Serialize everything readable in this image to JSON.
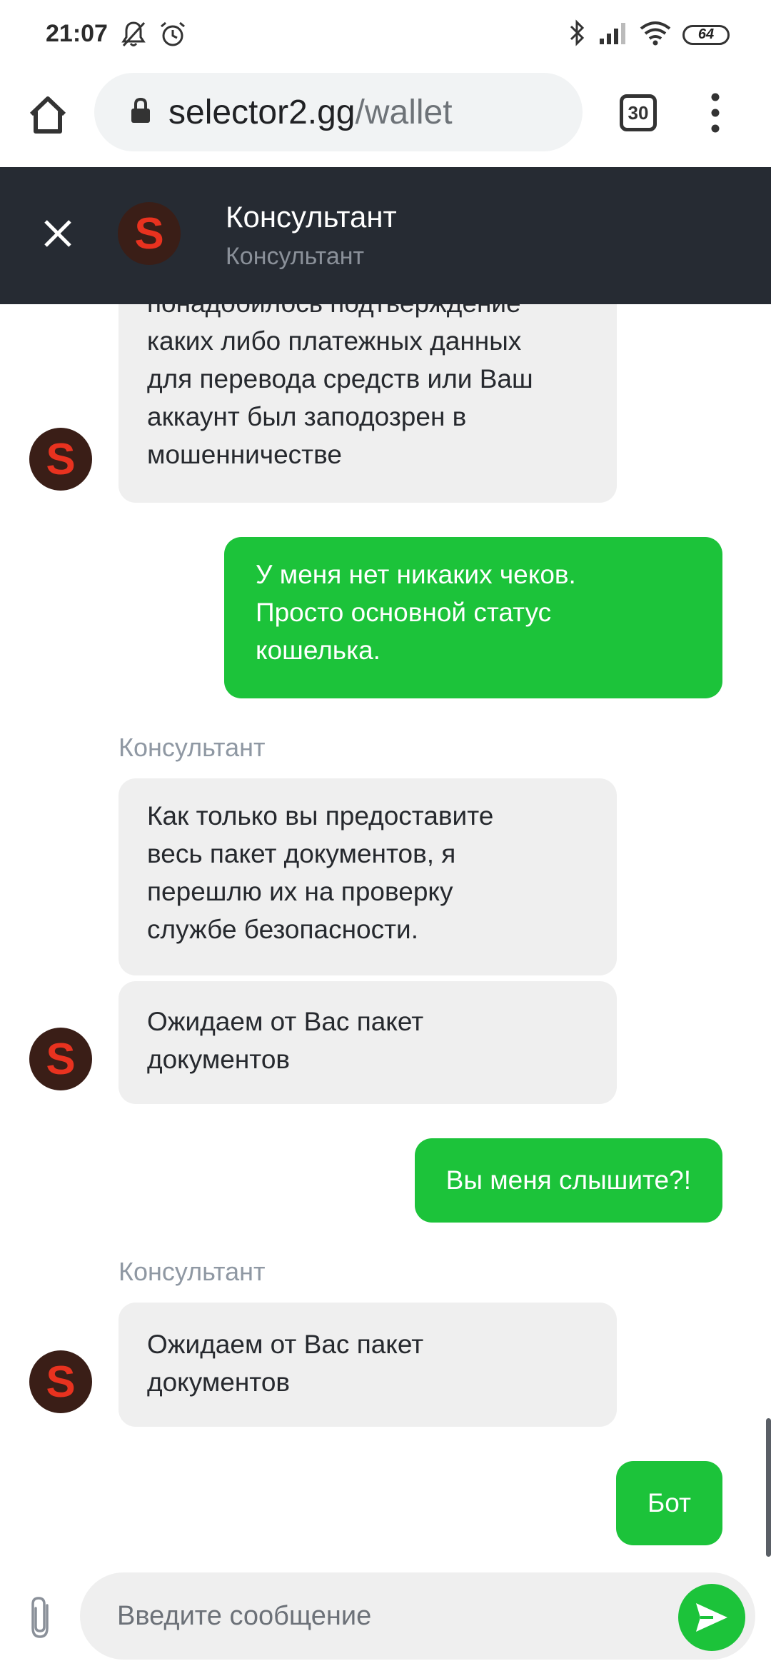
{
  "status_bar": {
    "time": "21:07",
    "battery": "64",
    "icons": [
      "bell-off-icon",
      "alarm-icon",
      "bluetooth-icon",
      "signal-icon",
      "wifi-icon",
      "battery-icon"
    ]
  },
  "browser": {
    "url_host": "selector2.gg",
    "url_path": "/wallet",
    "tab_count": "30",
    "icons": [
      "home-icon",
      "lock-icon",
      "tabs-icon",
      "menu-dots-icon"
    ]
  },
  "chat_header": {
    "title": "Консультант",
    "subtitle": "Консультант",
    "avatar_letter": "S"
  },
  "messages": [
    {
      "from": "agent",
      "lines": [
        "понадобилось подтверждение",
        "каких либо платежных данных",
        "для перевода средств или Ваш",
        "аккаунт был заподозрен в",
        "мошенничестве"
      ]
    },
    {
      "from": "user",
      "lines": [
        "У меня нет никаких чеков.",
        "Просто основной статус",
        "кошелька."
      ]
    },
    {
      "from": "agent",
      "sender": "Консультант",
      "lines": [
        "Как только вы предоставите",
        "весь пакет документов, я",
        "перешлю их на проверку",
        "службе безопасности."
      ]
    },
    {
      "from": "agent",
      "lines": [
        "Ожидаем от Вас пакет",
        "документов"
      ]
    },
    {
      "from": "user",
      "lines": [
        "Вы меня слышите?!"
      ]
    },
    {
      "from": "agent",
      "sender": "Консультант",
      "lines": [
        "Ожидаем от Вас пакет",
        "документов"
      ]
    },
    {
      "from": "user",
      "lines": [
        "Бот"
      ]
    }
  ],
  "input": {
    "placeholder": "Введите сообщение"
  },
  "colors": {
    "header_bg": "#262b33",
    "user_bubble": "#1cc33a",
    "agent_bubble": "#efefef",
    "avatar_bg": "#3a1e17",
    "avatar_letter": "#e8321f"
  }
}
